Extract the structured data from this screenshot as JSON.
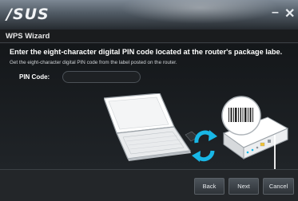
{
  "window": {
    "logo": "/SUS",
    "minimize_glyph": "–",
    "close_glyph": "✕"
  },
  "wizard": {
    "title": "WPS Wizard",
    "heading": "Enter the eight-character digital PIN code located at the router's package labe.",
    "subtext": "Get the eight-character digital PIN code from the label posted on the router.",
    "pin_label": "PIN Code:",
    "pin_value": "",
    "pin_placeholder": ""
  },
  "buttons": {
    "back": "Back",
    "next": "Next",
    "cancel": "Cancel"
  },
  "colors": {
    "accent_cyan": "#18b7e6",
    "background": "#1b1d1f"
  }
}
